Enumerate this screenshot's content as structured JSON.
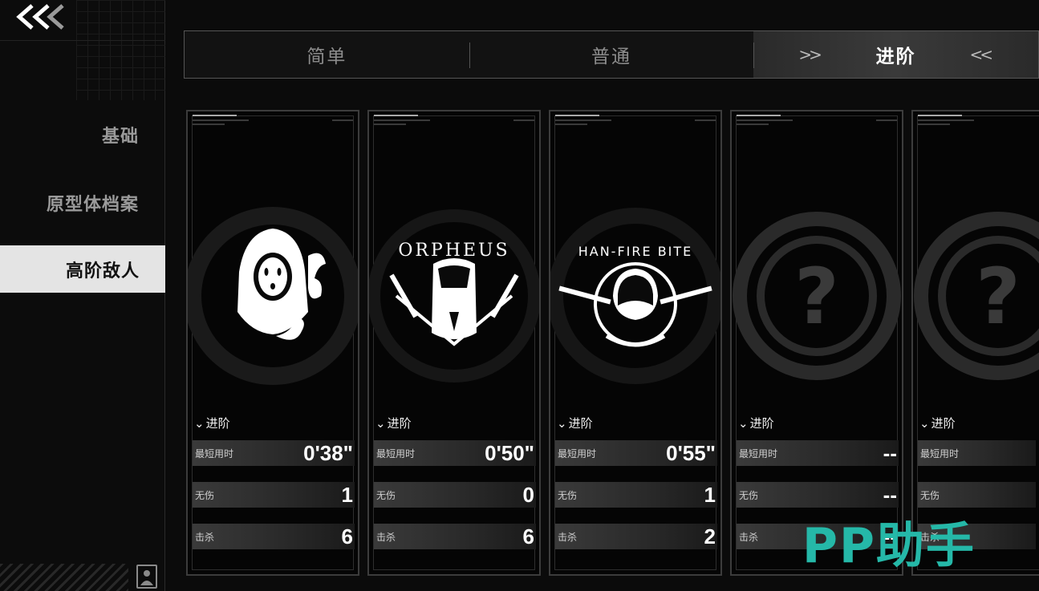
{
  "nav": {
    "back_icon": "double-chevron-left-icon",
    "items": [
      {
        "label": "基础"
      },
      {
        "label": "原型体档案"
      },
      {
        "label": "高阶敌人"
      }
    ]
  },
  "tabs": [
    {
      "label": "简单"
    },
    {
      "label": "普通"
    },
    {
      "label": "进阶"
    }
  ],
  "cards": [
    {
      "difficulty": "进阶",
      "best_time_label": "最短用时",
      "best_time": "0'38\"",
      "no_damage_label": "无伤",
      "no_damage": "1",
      "kills_label": "击杀",
      "kills": "6",
      "emblem_text": "",
      "locked": false
    },
    {
      "difficulty": "进阶",
      "best_time_label": "最短用时",
      "best_time": "0'50\"",
      "no_damage_label": "无伤",
      "no_damage": "0",
      "kills_label": "击杀",
      "kills": "6",
      "emblem_text": "ORPHEUS",
      "locked": false
    },
    {
      "difficulty": "进阶",
      "best_time_label": "最短用时",
      "best_time": "0'55\"",
      "no_damage_label": "无伤",
      "no_damage": "1",
      "kills_label": "击杀",
      "kills": "2",
      "emblem_text": "HAN-FIRE BITE",
      "locked": false
    },
    {
      "difficulty": "进阶",
      "best_time_label": "最短用时",
      "best_time": "--",
      "no_damage_label": "无伤",
      "no_damage": "--",
      "kills_label": "击杀",
      "kills": "--",
      "emblem_text": "?",
      "locked": true
    },
    {
      "difficulty": "进阶",
      "best_time_label": "最短用时",
      "best_time": "",
      "no_damage_label": "无伤",
      "no_damage": "",
      "kills_label": "击杀",
      "kills": "",
      "emblem_text": "?",
      "locked": true
    }
  ],
  "watermark": "PP助手"
}
